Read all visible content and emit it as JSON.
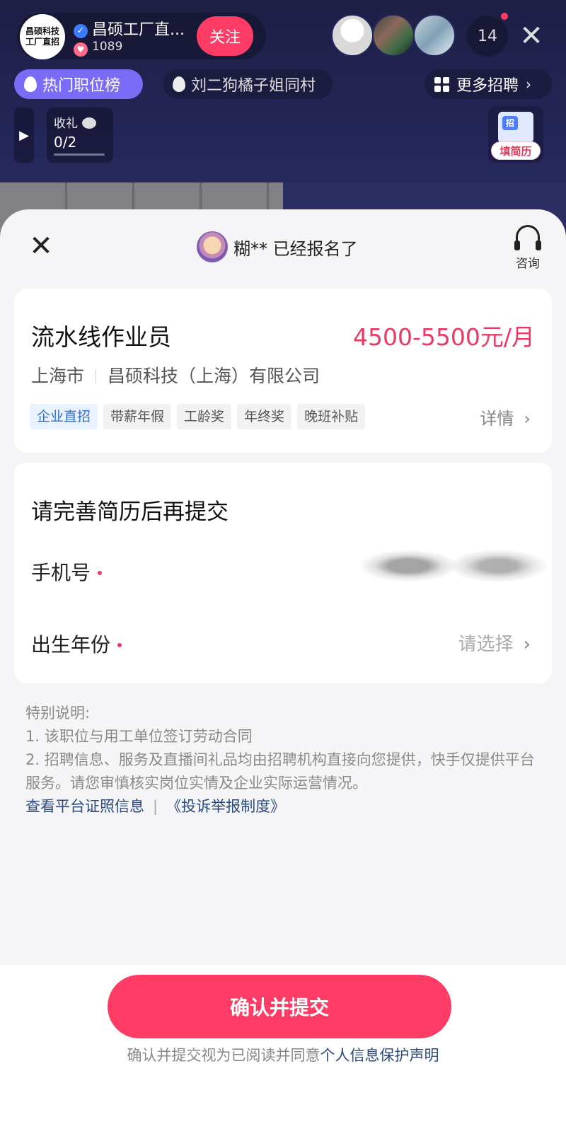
{
  "live": {
    "host_avatar_line1": "昌硕科技",
    "host_avatar_line2": "工厂直招",
    "host_name": "昌硕工厂直...",
    "likes": "1089",
    "follow_label": "关注",
    "viewer_count": "14",
    "hot_jobs_label": "热门职位榜",
    "ticker_text": "刘二狗橘子姐同村",
    "more_jobs_label": "更多招聘",
    "gift_label": "收礼",
    "gift_progress": "0/2",
    "resume_icon_char": "招",
    "resume_label": "填简历"
  },
  "sheet": {
    "signup_text": "糊** 已经报名了",
    "consult_label": "咨询",
    "job": {
      "title": "流水线作业员",
      "salary": "4500-5500元/月",
      "city": "上海市",
      "company": "昌硕科技（上海）有限公司",
      "tags": [
        "企业直招",
        "带薪年假",
        "工龄奖",
        "年终奖",
        "晚班补贴"
      ],
      "detail_label": "详情"
    },
    "form": {
      "title": "请完善简历后再提交",
      "phone_label": "手机号",
      "birth_label": "出生年份",
      "birth_placeholder": "请选择"
    },
    "notice": {
      "heading": "特别说明:",
      "line1": "1. 该职位与用工单位签订劳动合同",
      "line2": "2. 招聘信息、服务及直播间礼品均由招聘机构直接向您提供，快手仅提供平台服务。请您审慎核实岗位实情及企业实际运营情况。",
      "link_license": "查看平台证照信息",
      "link_report": "《投诉举报制度》"
    },
    "submit_label": "确认并提交",
    "consent_prefix": "确认并提交视为已阅读并同意",
    "consent_link": "个人信息保护声明"
  },
  "colors": {
    "accent": "#fe3c66",
    "salary": "#e83a64",
    "link": "#2c4a7a",
    "tag_primary": "#2f6fd6"
  }
}
